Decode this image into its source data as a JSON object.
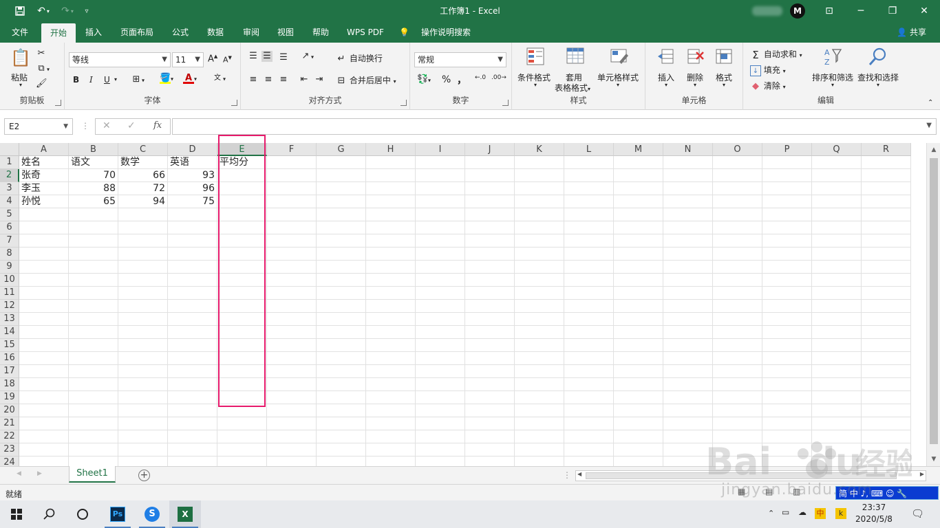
{
  "window": {
    "title": "工作簿1  -  Excel",
    "user_initial": "M",
    "minimize": "─",
    "maximize": "❐",
    "close": "✕",
    "ribbon_display": "⊡"
  },
  "menu": {
    "tabs": [
      "文件",
      "开始",
      "插入",
      "页面布局",
      "公式",
      "数据",
      "审阅",
      "视图",
      "帮助",
      "WPS PDF",
      "操作说明搜索"
    ],
    "active_index": 1,
    "share": "共享"
  },
  "ribbon": {
    "clipboard": {
      "label": "剪贴板",
      "paste": "粘贴"
    },
    "font": {
      "label": "字体",
      "font_name": "等线",
      "font_size": "11",
      "bold": "B",
      "italic": "I",
      "underline": "U"
    },
    "alignment": {
      "label": "对齐方式",
      "wrap_text": "自动换行",
      "merge_center": "合并后居中"
    },
    "number": {
      "label": "数字",
      "format": "常规",
      "percent": "%",
      "comma": "，"
    },
    "styles": {
      "label": "样式",
      "conditional": "条件格式",
      "table_format_1": "套用",
      "table_format_2": "表格格式",
      "cell_styles": "单元格样式"
    },
    "cells": {
      "label": "单元格",
      "insert": "插入",
      "delete": "删除",
      "format": "格式"
    },
    "editing": {
      "label": "编辑",
      "autosum": "自动求和",
      "fill": "填充",
      "clear": "清除",
      "sort_filter": "排序和筛选",
      "find_select": "查找和选择"
    }
  },
  "formula_bar": {
    "name_box": "E2",
    "fx": "fx",
    "value": ""
  },
  "grid": {
    "columns": [
      "A",
      "B",
      "C",
      "D",
      "E",
      "F",
      "G",
      "H",
      "I",
      "J",
      "K",
      "L",
      "M",
      "N",
      "O",
      "P",
      "Q",
      "R"
    ],
    "rows": [
      "1",
      "2",
      "3",
      "4",
      "5",
      "6",
      "7",
      "8",
      "9",
      "10",
      "11",
      "12",
      "13",
      "14",
      "15",
      "16",
      "17",
      "18",
      "19",
      "20",
      "21",
      "22",
      "23",
      "24"
    ],
    "selected_column": "E",
    "selected_row": "2",
    "cells": {
      "A1": "姓名",
      "B1": "语文",
      "C1": "数学",
      "D1": "英语",
      "E1": "平均分",
      "A2": "张奇",
      "B2": "70",
      "C2": "66",
      "D2": "93",
      "A3": "李玉",
      "B3": "88",
      "C3": "72",
      "D3": "96",
      "A4": "孙悦",
      "B4": "65",
      "C4": "94",
      "D4": "75"
    }
  },
  "sheets": {
    "tabs": [
      "Sheet1"
    ],
    "add": "+"
  },
  "status": {
    "text": "就绪",
    "ime": "简 中 ♪, ⌨ ☺ 🔧"
  },
  "taskbar": {
    "time": "23:37",
    "date": "2020/5/8",
    "ime_cn": "中",
    "tray_k": "k"
  },
  "watermark": {
    "text": "jingyan.baidu.com"
  },
  "colors": {
    "excel_green": "#217346",
    "highlight": "#e6196b"
  }
}
